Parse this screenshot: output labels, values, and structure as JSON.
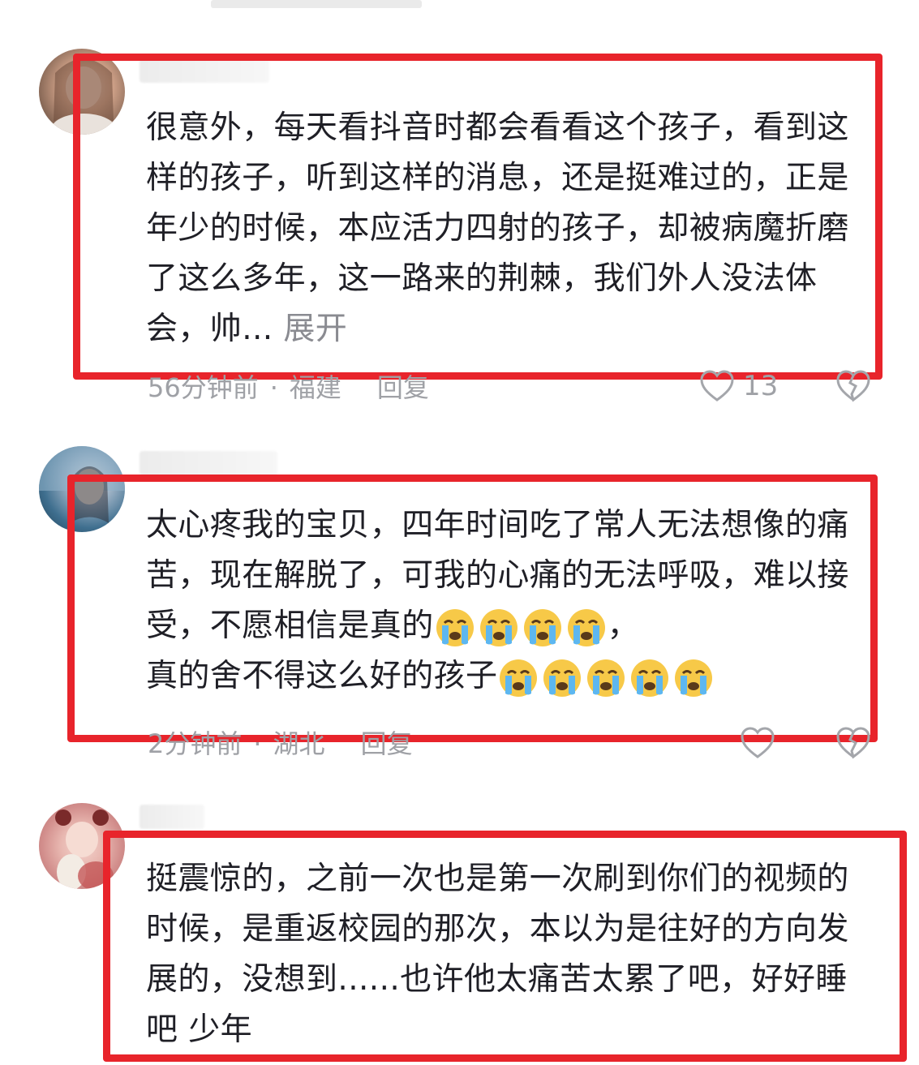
{
  "comments": [
    {
      "text": "很意外，每天看抖音时都会看看这个孩子，看到这样的孩子，听到这样的消息，还是挺难过的，正是年少的时候，本应活力四射的孩子，却被病魔折磨了这么多年，这一路来的荆棘，我们外人没法体会，帅...",
      "expand_label": "展开",
      "time": "56分钟前",
      "location": "福建",
      "reply_label": "回复",
      "like_count": "13"
    },
    {
      "text_main": "太心疼我的宝贝，四年时间吃了常人无法想像的痛苦，现在解脱了，可我的心痛的无法呼吸，难以接受，不愿相信是真的",
      "comma": "，",
      "text_tail": "真的舍不得这么好的孩子",
      "time": "2分钟前",
      "location": "湖北",
      "reply_label": "回复"
    },
    {
      "text": "挺震惊的，之前一次也是第一次刷到你们的视频的时候，是重返校园的那次，本以为是往好的方向发展的，没想到......也许他太痛苦太累了吧，好好睡吧 少年"
    }
  ],
  "meta_separator": "·",
  "icons": [
    "heart-icon",
    "dislike-icon",
    "crying-emoji-icon"
  ],
  "colors": {
    "highlight": "#e8242b",
    "meta": "#9fa1a6",
    "text": "#1f1f26",
    "expand": "#8a8b91"
  }
}
